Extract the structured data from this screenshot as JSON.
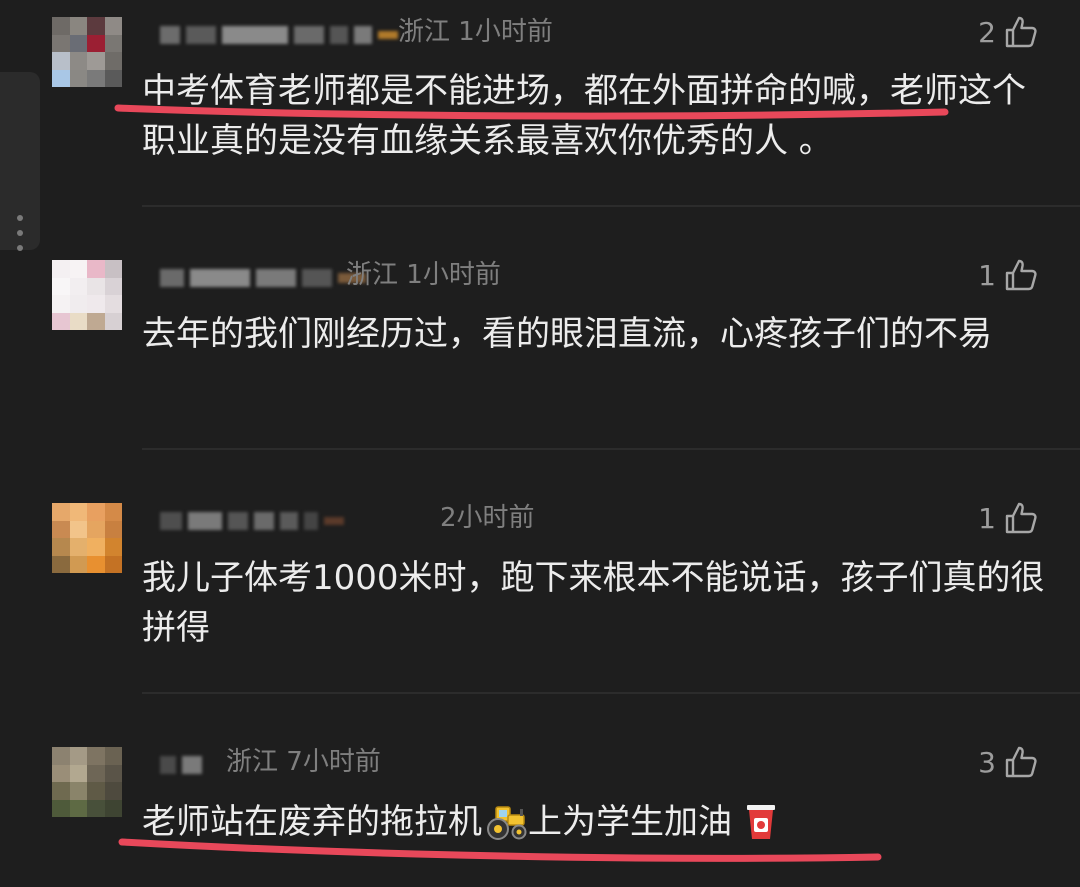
{
  "comments": [
    {
      "location": "浙江",
      "time": "1小时前",
      "likes": "2",
      "text": "中考体育老师都是不能进场，都在外面拼命的喊，老师这个职业真的是没有血缘关系最喜欢你优秀的人 。"
    },
    {
      "location": "浙江",
      "time": "1小时前",
      "likes": "1",
      "text": "去年的我们刚经历过，看的眼泪直流，心疼孩子们的不易"
    },
    {
      "location": "",
      "time": "2小时前",
      "likes": "1",
      "text": "我儿子体考1000米时，跑下来根本不能说话，孩子们真的很拼得"
    },
    {
      "location": "浙江",
      "time": "7小时前",
      "likes": "3",
      "text_part1": "老师站在废弃的拖拉机",
      "text_part2": "上为学生加油"
    }
  ],
  "icons": {
    "like": "thumbs-up-icon",
    "tractor": "tractor-emoji-icon",
    "cup": "drink-cup-emoji-icon"
  },
  "colors": {
    "background": "#1e1e1e",
    "text": "#ececec",
    "meta": "#7f7f7f",
    "highlight_underline": "#e8485a"
  }
}
